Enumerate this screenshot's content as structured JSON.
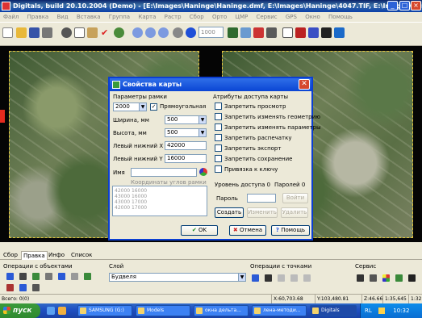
{
  "window": {
    "title": "Digitals, build 20.10.2004 (Demo) - [E:\\Images\\Haninge\\Haninge.dmf, E:\\Images\\Haninge\\4047.TIF, E:\\Images\\Haninge..."
  },
  "menu": [
    "Файл",
    "Правка",
    "Вид",
    "Вставка",
    "Группа",
    "Карта",
    "Растр",
    "Сбор",
    "Орто",
    "ЦМР",
    "Сервис",
    "GPS",
    "Окно",
    "Помощь"
  ],
  "toolbar": {
    "scale_value": "1000"
  },
  "dialog": {
    "title": "Свойства карты",
    "frame_params_label": "Параметры рамки",
    "frame_scale": "2000",
    "rect_label": "Прямоугольная",
    "rect_checked": "✓",
    "width_label": "Ширина, мм",
    "width_value": "500",
    "height_label": "Высота, мм",
    "height_value": "500",
    "left_x_label": "Левый нижний X",
    "left_x_value": "42000",
    "left_y_label": "Левый нижний Y",
    "left_y_value": "16000",
    "name_label": "Имя",
    "name_value": "",
    "corners_label": "Координаты углов рамки",
    "corners": [
      "42000 16000",
      "43000 16000",
      "43000 17000",
      "42000 17000"
    ],
    "access_label": "Атрибуты доступа карты",
    "access_items": [
      "Запретить просмотр",
      "Запретить изменять геометрию",
      "Запретить изменять параметры",
      "Запретить распечатку",
      "Запретить экспорт",
      "Запретить сохранение",
      "Привязка к ключу"
    ],
    "access_level": "Уровень доступа 0",
    "passwords": "Паролей 0",
    "password_label": "Пароль",
    "password_value": "",
    "login_button": "Войти",
    "create_button": "Создать",
    "change_button": "Изменить",
    "delete_button": "Удалить",
    "ok_button": "OK",
    "cancel_button": "Отмена",
    "help_button": "Помощь"
  },
  "tabs": [
    "Сбор",
    "Правка",
    "Инфо",
    "Список"
  ],
  "active_tab": "Правка",
  "panel": {
    "ops_objects": "Операции с объектами",
    "layer_label": "Слой",
    "layer_value": "Будвеля",
    "ops_points": "Операции с точками",
    "service": "Сервис"
  },
  "status": {
    "total": "Всего: 0(0)",
    "x": "X:60,703.68",
    "y": "Y:103,480.81",
    "z": "Z:46.66",
    "scale": "1:35,645",
    "zoom": "1:32"
  },
  "taskbar": {
    "start": "пуск",
    "tasks": [
      "SAMSUNG (G:)",
      "Models",
      "окна дельта...",
      "лена-методи...",
      "Digitals"
    ],
    "lang": "RL",
    "clock": "10:32"
  }
}
